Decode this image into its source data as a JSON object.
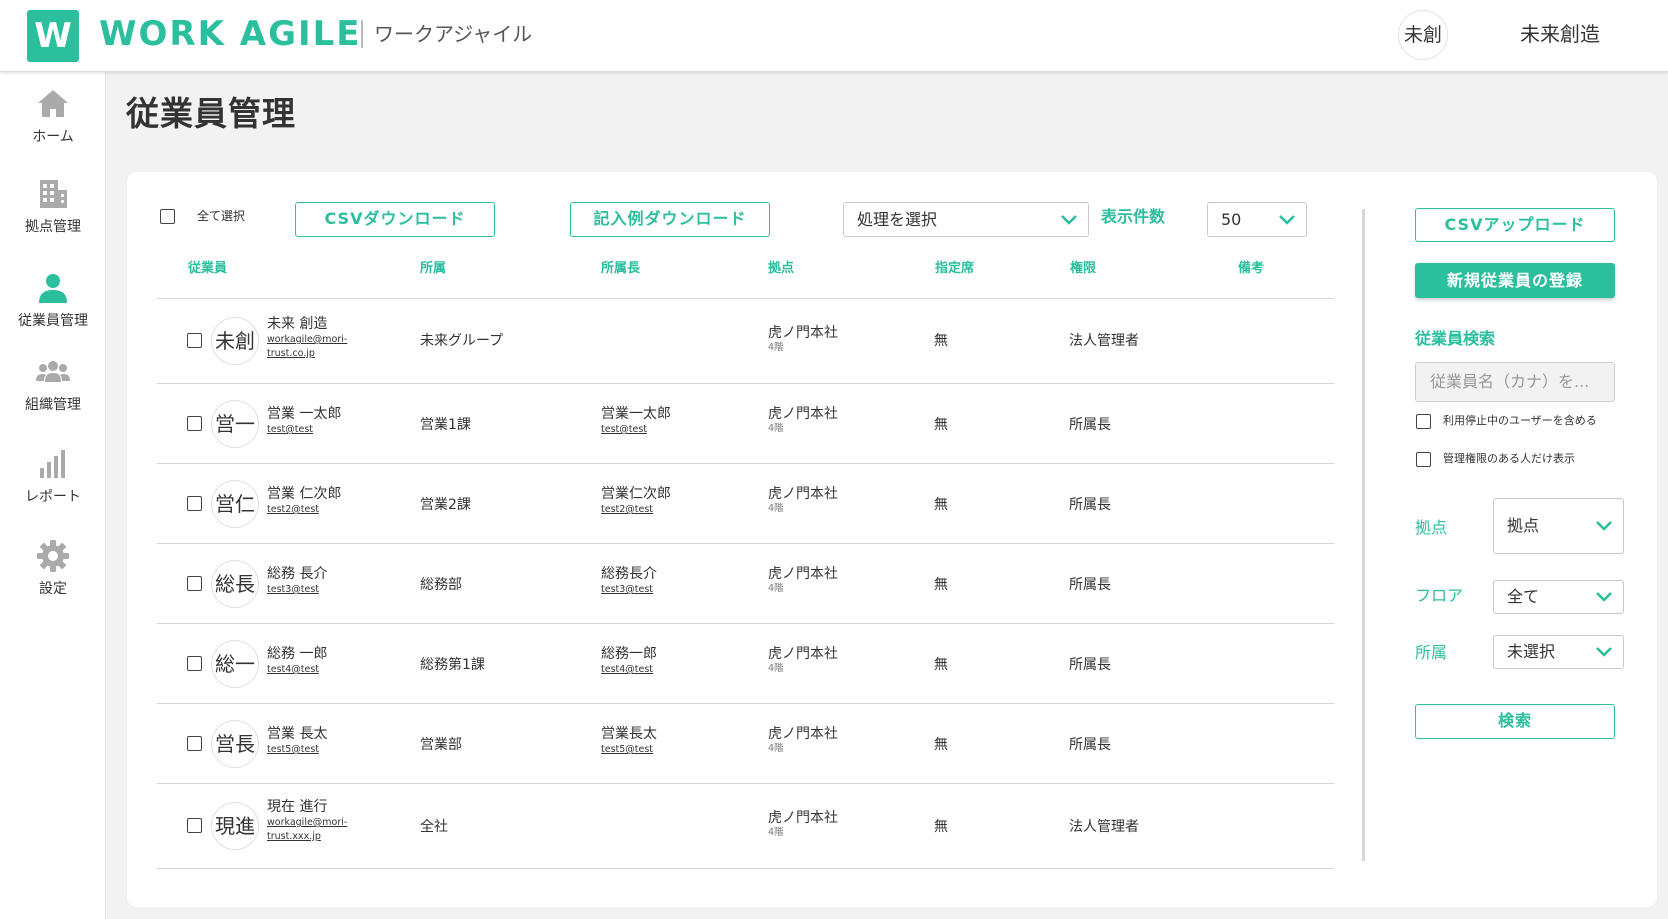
{
  "header": {
    "logo_letter": "W",
    "logo_text": "WORK AGILE",
    "logo_subtitle": "ワークアジャイル",
    "user_avatar": "未創",
    "user_name": "未来創造"
  },
  "sidebar": {
    "items": [
      {
        "label": "ホーム",
        "icon": "home-icon"
      },
      {
        "label": "拠点管理",
        "icon": "building-icon"
      },
      {
        "label": "従業員管理",
        "icon": "person-icon"
      },
      {
        "label": "組織管理",
        "icon": "group-icon"
      },
      {
        "label": "レポート",
        "icon": "bar-chart-icon"
      },
      {
        "label": "設定",
        "icon": "gear-icon"
      }
    ]
  },
  "page": {
    "title": "従業員管理"
  },
  "toolbar": {
    "select_all": "全て選択",
    "csv_download": "CSVダウンロード",
    "sample_download": "記入例ダウンロード",
    "action_select": "処理を選択",
    "per_page_label": "表示件数",
    "per_page_value": "50"
  },
  "table": {
    "headers": [
      "従業員",
      "所属",
      "所属長",
      "拠点",
      "指定席",
      "権限",
      "備考"
    ],
    "rows": [
      {
        "avatar": "未創",
        "name": "未来 創造",
        "email_line1": "workagile@mori-",
        "email_line2": "trust.co.jp",
        "dept": "未来グループ",
        "manager": "",
        "manager_email": "",
        "site": "虎ノ門本社",
        "floor": "4階",
        "seat": "無",
        "role": "法人管理者",
        "note": ""
      },
      {
        "avatar": "営一",
        "name": "営業 一太郎",
        "email_line1": "test@test",
        "email_line2": "",
        "dept": "営業1課",
        "manager": "営業一太郎",
        "manager_email": "test@test",
        "site": "虎ノ門本社",
        "floor": "4階",
        "seat": "無",
        "role": "所属長",
        "note": ""
      },
      {
        "avatar": "営仁",
        "name": "営業 仁次郎",
        "email_line1": "test2@test",
        "email_line2": "",
        "dept": "営業2課",
        "manager": "営業仁次郎",
        "manager_email": "test2@test",
        "site": "虎ノ門本社",
        "floor": "4階",
        "seat": "無",
        "role": "所属長",
        "note": ""
      },
      {
        "avatar": "総長",
        "name": "総務 長介",
        "email_line1": "test3@test",
        "email_line2": "",
        "dept": "総務部",
        "manager": "総務長介",
        "manager_email": "test3@test",
        "site": "虎ノ門本社",
        "floor": "4階",
        "seat": "無",
        "role": "所属長",
        "note": ""
      },
      {
        "avatar": "総一",
        "name": "総務 一郎",
        "email_line1": "test4@test",
        "email_line2": "",
        "dept": "総務第1課",
        "manager": "総務一郎",
        "manager_email": "test4@test",
        "site": "虎ノ門本社",
        "floor": "4階",
        "seat": "無",
        "role": "所属長",
        "note": ""
      },
      {
        "avatar": "営長",
        "name": "営業 長太",
        "email_line1": "test5@test",
        "email_line2": "",
        "dept": "営業部",
        "manager": "営業長太",
        "manager_email": "test5@test",
        "site": "虎ノ門本社",
        "floor": "4階",
        "seat": "無",
        "role": "所属長",
        "note": ""
      },
      {
        "avatar": "現進",
        "name": "現在 進行",
        "email_line1": "workagile@mori-",
        "email_line2": "trust.xxx.jp",
        "dept": "全社",
        "manager": "",
        "manager_email": "",
        "site": "虎ノ門本社",
        "floor": "4階",
        "seat": "無",
        "role": "法人管理者",
        "note": ""
      }
    ]
  },
  "side_panel": {
    "csv_upload": "CSVアップロード",
    "register": "新規従業員の登録",
    "search_title": "従業員検索",
    "search_placeholder": "従業員名（カナ）を...",
    "include_disabled": "利用停止中のユーザーを含める",
    "admin_only": "管理権限のある人だけ表示",
    "site_label": "拠点",
    "site_value": "拠点",
    "floor_label": "フロア",
    "floor_value": "全て",
    "dept_label": "所属",
    "dept_value": "未選択",
    "search_button": "検索"
  },
  "colors": {
    "accent": "#2bbf9e",
    "background": "#f2f2f2"
  }
}
